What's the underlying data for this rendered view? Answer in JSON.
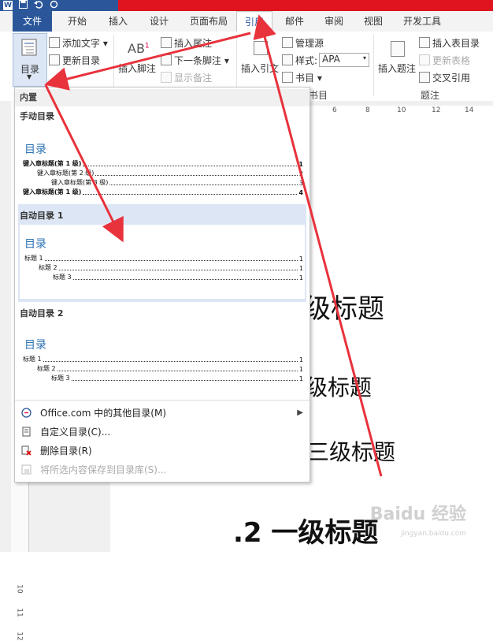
{
  "app": {
    "logo": "W",
    "qat_icons": [
      "save-icon",
      "undo-icon",
      "redo-icon"
    ]
  },
  "tabs": [
    "文件",
    "开始",
    "插入",
    "设计",
    "页面布局",
    "引用",
    "邮件",
    "审阅",
    "视图",
    "开发工具"
  ],
  "active_tab": "引用",
  "ribbon": {
    "toc_button": "目录",
    "add_text": "添加文字",
    "update_toc": "更新目录",
    "insert_footnote": "插入脚注",
    "insert_endnote": "插入尾注",
    "next_footnote": "下一条脚注",
    "show_notes": "显示备注",
    "insert_citation": "插入引文",
    "manage_sources": "管理源",
    "style_label": "样式:",
    "style_value": "APA",
    "bibliography": "书目",
    "citation_group": "书目",
    "insert_caption": "插入题注",
    "insert_table_of_figures": "插入表目录",
    "update_table": "更新表格",
    "cross_reference": "交叉引用",
    "caption_group": "题注"
  },
  "hruler_numbers": [
    "6",
    "8",
    "10",
    "12",
    "14"
  ],
  "vruler_numbers": [
    "10",
    "11",
    "12"
  ],
  "dropdown": {
    "section_builtin": "内置",
    "manual_label": "手动目录",
    "manual_title": "目录",
    "manual_entries": [
      {
        "text": "键入章标题(第 1 级)",
        "page": "1",
        "level": 1
      },
      {
        "text": "键入章标题(第 2 级)",
        "page": "2",
        "level": 2
      },
      {
        "text": "键入章标题(第 3 级)",
        "page": "3",
        "level": 3
      },
      {
        "text": "键入章标题(第 1 级)",
        "page": "4",
        "level": 1
      }
    ],
    "auto1_label": "自动目录 1",
    "auto1_title": "目录",
    "auto1_entries": [
      {
        "text": "标题 1",
        "page": "1",
        "level": 1
      },
      {
        "text": "标题 2",
        "page": "1",
        "level": 2
      },
      {
        "text": "标题 3",
        "page": "1",
        "level": 3
      }
    ],
    "auto2_label": "自动目录 2",
    "auto2_title": "目录",
    "auto2_entries": [
      {
        "text": "标题 1",
        "page": "1",
        "level": 1
      },
      {
        "text": "标题 2",
        "page": "1",
        "level": 2
      },
      {
        "text": "标题 3",
        "page": "1",
        "level": 3
      }
    ],
    "menu": {
      "more_office": "Office.com 中的其他目录(M)",
      "custom_toc": "自定义目录(C)...",
      "remove_toc": "删除目录(R)",
      "save_selection": "将所选内容保存到目录库(S)..."
    }
  },
  "document": {
    "heading1": "级标题",
    "heading2": "级标题",
    "heading3": "三级标题",
    "heading4": ".2 一级标题"
  },
  "watermark": {
    "main": "Baidu 经验",
    "sub": "jingyan.baidu.com"
  },
  "colors": {
    "word_blue": "#2b579a",
    "arrow_red": "#e8323c",
    "toc_blue": "#2e74b5"
  }
}
